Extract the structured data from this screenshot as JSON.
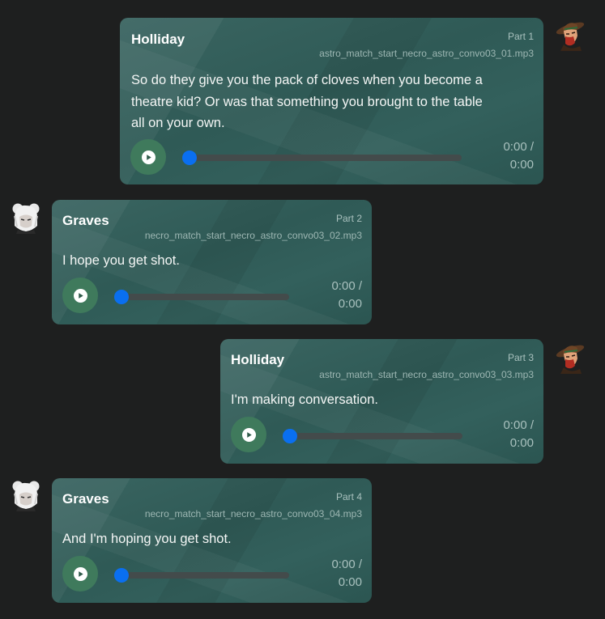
{
  "messages": [
    {
      "speaker": "Holliday",
      "part": "Part 1",
      "file": "astro_match_start_necro_astro_convo03_01.mp3",
      "lines": [
        "So do they give you the pack of cloves when you become a",
        "theatre kid? Or was that something you brought to the table",
        "all on your own."
      ],
      "time_current": "0:00 /",
      "time_total": "0:00",
      "progress": 0,
      "avatar": "cowboy-avatar"
    },
    {
      "speaker": "Graves",
      "part": "Part 2",
      "file": "necro_match_start_necro_astro_convo03_02.mp3",
      "lines": [
        "I hope you get shot."
      ],
      "time_current": "0:00 /",
      "time_total": "0:00",
      "progress": 0,
      "avatar": "white-haired-avatar"
    },
    {
      "speaker": "Holliday",
      "part": "Part 3",
      "file": "astro_match_start_necro_astro_convo03_03.mp3",
      "lines": [
        "I'm making conversation."
      ],
      "time_current": "0:00 /",
      "time_total": "0:00",
      "progress": 0,
      "avatar": "cowboy-avatar"
    },
    {
      "speaker": "Graves",
      "part": "Part 4",
      "file": "necro_match_start_necro_astro_convo03_04.mp3",
      "lines": [
        "And I'm hoping you get shot."
      ],
      "time_current": "0:00 /",
      "time_total": "0:00",
      "progress": 0,
      "avatar": "white-haired-avatar"
    }
  ],
  "colors": {
    "background": "#1e1f1f",
    "bubble": "#33605c",
    "play_button": "#3f7a5c",
    "seek_thumb": "#0a6ff0",
    "track": "#434b4b"
  },
  "icons": {
    "play": "play-icon"
  }
}
